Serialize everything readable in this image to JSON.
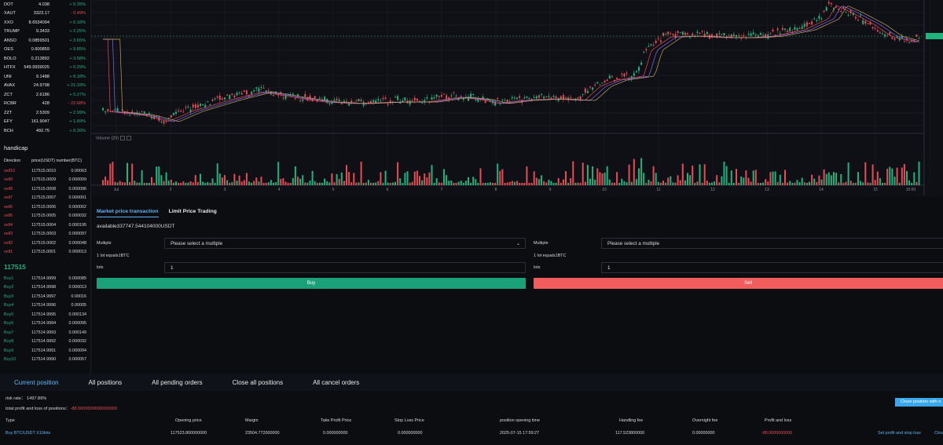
{
  "coin_list": [
    {
      "symbol": "DOT",
      "price": "4.038",
      "change": "+ 5.35%",
      "dir": "up"
    },
    {
      "symbol": "XAUT",
      "price": "3323.17",
      "change": "- 0.49%",
      "dir": "down"
    },
    {
      "symbol": "XXO",
      "price": "8.6534094",
      "change": "+ 0.18%",
      "dir": "up"
    },
    {
      "symbol": "TRUMP",
      "price": "9.3433",
      "change": "+ 2.25%",
      "dir": "up"
    },
    {
      "symbol": "ANSO",
      "price": "0.0859501",
      "change": "+ 3.65%",
      "dir": "up"
    },
    {
      "symbol": "OES",
      "price": "0.600859",
      "change": "+ 9.85%",
      "dir": "up"
    },
    {
      "symbol": "BOLO",
      "price": "0.213892",
      "change": "+ 3.58%",
      "dir": "up"
    },
    {
      "symbol": "HTFX",
      "price": "549.9939025",
      "change": "+ 0.29%",
      "dir": "up"
    },
    {
      "symbol": "UNI",
      "price": "9.1488",
      "change": "+ 8.18%",
      "dir": "up"
    },
    {
      "symbol": "AVAX",
      "price": "24.9798",
      "change": "+ 21.33%",
      "dir": "up"
    },
    {
      "symbol": "ZCT",
      "price": "2.6186",
      "change": "+ 5.27%",
      "dir": "up"
    },
    {
      "symbol": "RCBR",
      "price": "428",
      "change": "- 22.68%",
      "dir": "down"
    },
    {
      "symbol": "ZZT",
      "price": "2.5309",
      "change": "+ 2.99%",
      "dir": "up"
    },
    {
      "symbol": "EFY",
      "price": "161.9047",
      "change": "+ 1.69%",
      "dir": "up"
    },
    {
      "symbol": "BCH",
      "price": "492.75",
      "change": "+ 0.30%",
      "dir": "up"
    }
  ],
  "handicap": {
    "title": "handicap",
    "col_direction": "Direction",
    "col_price_number": "price(USDT) number(BTC)",
    "sells": [
      {
        "label": "sell10",
        "price": "117515.0010",
        "qty": "0.00063"
      },
      {
        "label": "sell9",
        "price": "117515.0009",
        "qty": "0.000009"
      },
      {
        "label": "sell8",
        "price": "117515.0008",
        "qty": "0.000096"
      },
      {
        "label": "sell7",
        "price": "117515.0007",
        "qty": "0.000001"
      },
      {
        "label": "sell6",
        "price": "117515.0006",
        "qty": "0.000002"
      },
      {
        "label": "sell5",
        "price": "117515.0005",
        "qty": "0.000032"
      },
      {
        "label": "sell4",
        "price": "117515.0004",
        "qty": "0.000195"
      },
      {
        "label": "sell3",
        "price": "117515.0003",
        "qty": "0.000097"
      },
      {
        "label": "sell2",
        "price": "117515.0002",
        "qty": "0.000048"
      },
      {
        "label": "sell1",
        "price": "117515.0001",
        "qty": "0.000013"
      }
    ],
    "mid_price": "117515",
    "buys": [
      {
        "label": "Buy1",
        "price": "117514.9999",
        "qty": "0.000085"
      },
      {
        "label": "Buy2",
        "price": "117514.9998",
        "qty": "0.000013"
      },
      {
        "label": "Buy3",
        "price": "117514.9997",
        "qty": "0.00016"
      },
      {
        "label": "Buy4",
        "price": "117514.9996",
        "qty": "0.00005"
      },
      {
        "label": "Buy5",
        "price": "117514.9995",
        "qty": "0.000134"
      },
      {
        "label": "Buy6",
        "price": "117514.9994",
        "qty": "0.000095"
      },
      {
        "label": "Buy7",
        "price": "117514.9993",
        "qty": "0.000149"
      },
      {
        "label": "Buy8",
        "price": "117514.9992",
        "qty": "0.000032"
      },
      {
        "label": "Buy9",
        "price": "117514.9991",
        "qty": "0.000094"
      },
      {
        "label": "Buy10",
        "price": "117514.9990",
        "qty": "0.000057"
      }
    ]
  },
  "chart": {
    "volume_label": "Volume (20)",
    "x_ticks": [
      "Jul",
      "2",
      "3",
      "4",
      "5",
      "6",
      "7",
      "8",
      "9",
      "10",
      "11",
      "12",
      "13",
      "14",
      "15",
      "15:00"
    ],
    "up_color": "#1fb37e",
    "down_color": "#e94b55"
  },
  "trade": {
    "tab_market": "Market price transaction",
    "tab_limit": "Limit Price Trading",
    "available": "available337747.544104000USDT",
    "buy_form": {
      "multiple_label": "Multiple",
      "multiple_placeholder": "Please select a multiple",
      "lot_info": "1 lot equals1BTC",
      "lots_label": "lots",
      "lots_value": "1",
      "button": "Buy"
    },
    "sell_form": {
      "multiple_label": "Multiple",
      "multiple_placeholder": "Please select a multiple",
      "lot_info": "1 lot equals1BTC",
      "lots_label": "lots",
      "lots_value": "1",
      "button": "Sell"
    }
  },
  "positions": {
    "tabs": [
      "Current position",
      "All positions",
      "All pending orders",
      "Close all positions",
      "All cancel orders"
    ],
    "risk_rate": "risk rate： 1497.89%",
    "total_pl_label": "total profit and loss of positions：",
    "total_pl_value": "-88.0000000000000000",
    "close_button": "Close position with o",
    "columns": [
      "Type",
      "Opening price",
      "Margin",
      "Take Profit Price",
      "Stop Loss Price",
      "position opening time",
      "Handling fee",
      "Overnight fee",
      "Profit and loss"
    ],
    "row": {
      "type": "Buy BTC/USDT X10lots",
      "opening_price": "117523.800000000",
      "margin": "23504.772000000",
      "take_profit": "0.000000000",
      "stop_loss": "0.000000000",
      "open_time": "2025-07-15 17:59:27",
      "handling_fee": "117.523800000",
      "overnight_fee": "0.00000000",
      "pnl": "-88.0000000000",
      "action_set": "Set profit and stop loss",
      "action_close": "Clos"
    }
  }
}
